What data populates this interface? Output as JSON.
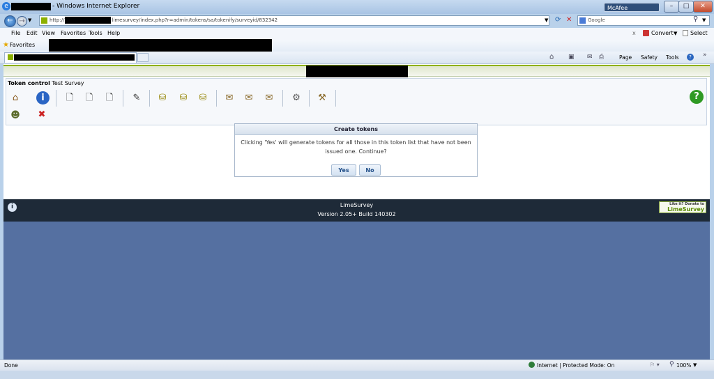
{
  "window": {
    "title": "- Windows Internet Explorer",
    "minimize": "–",
    "maximize": "□",
    "close": "✕",
    "mcafee": "McAfee"
  },
  "nav": {
    "url_prefix": "http://",
    "url_suffix": "limesurvey/index.php?r=admin/tokens/sa/tokenify/surveyid/832342",
    "search_placeholder": "Google"
  },
  "menu": {
    "items": [
      "File",
      "Edit",
      "View",
      "Favorites",
      "Tools",
      "Help"
    ],
    "convert": "Convert",
    "select": "Select"
  },
  "favorites": {
    "label": "Favorites"
  },
  "commands": {
    "page": "Page",
    "safety": "Safety",
    "tools": "Tools"
  },
  "token_panel": {
    "title": "Token control",
    "survey_name": "Test Survey"
  },
  "dialog": {
    "title": "Create tokens",
    "message": "Clicking 'Yes' will generate tokens for all those in this token list that have not been issued one. Continue?",
    "yes": "Yes",
    "no": "No"
  },
  "footer": {
    "name": "LimeSurvey",
    "version": "Version 2.05+ Build 140302",
    "donate_top": "Like it? Donate to",
    "donate_brand": "LimeSurvey"
  },
  "status": {
    "done": "Done",
    "zone": "Internet | Protected Mode: On",
    "zoom": "100%"
  }
}
